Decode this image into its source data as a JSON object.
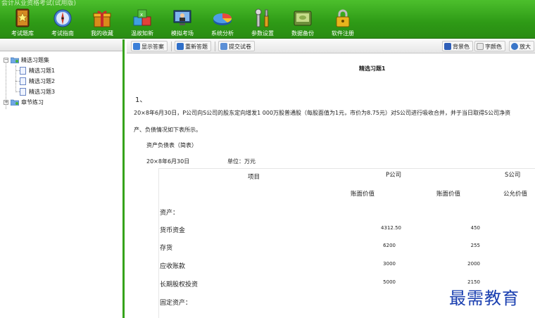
{
  "app": {
    "title": "会计从业资格考试(试用版)"
  },
  "toolbar": [
    {
      "label": "考试题库",
      "icon": "book-icon"
    },
    {
      "label": "考试指南",
      "icon": "compass-icon"
    },
    {
      "label": "我的收藏",
      "icon": "gift-box-icon"
    },
    {
      "label": "温故知新",
      "icon": "cubes-icon"
    },
    {
      "label": "模拟考场",
      "icon": "monitor-user-icon"
    },
    {
      "label": "系统分析",
      "icon": "pie-chart-icon"
    },
    {
      "label": "参数设置",
      "icon": "tools-icon"
    },
    {
      "label": "数据备份",
      "icon": "disk-icon"
    },
    {
      "label": "软件注册",
      "icon": "lock-icon"
    }
  ],
  "tree": {
    "root1": "精选习题集",
    "items": [
      "精选习题1",
      "精选习题2",
      "精选习题3"
    ],
    "root2": "章节练习"
  },
  "content_toolbar": {
    "show_answer": "显示答案",
    "redo": "重新答题",
    "submit": "提交试卷",
    "bg_color": "背景色",
    "font_color": "字颜色",
    "zoom": "放大"
  },
  "document": {
    "title": "精选习题1",
    "question_number": "1、",
    "text_line1": "20×8年6月30日，P公司向S公司的股东定向增发1 000万股普通股（每股面值为1元，市价为8.75元）对S公司进行吸收合并，并于当日取得S公司净资",
    "text_line2": "产、负债情况如下表所示。",
    "table_title": "资产负债表（简表）",
    "table_date": "20×8年6月30日",
    "table_unit": "单位：万元",
    "table": {
      "col_item": "项目",
      "col_p": "P公司",
      "col_s": "S公司",
      "sub_p_book": "账面价值",
      "sub_s_book": "账面价值",
      "sub_s_fair": "公允价值",
      "rows": [
        {
          "label": "资产：",
          "p": "",
          "s": ""
        },
        {
          "label": "货币资金",
          "p": "4312.50",
          "s": "450"
        },
        {
          "label": "存货",
          "p": "6200",
          "s": "255"
        },
        {
          "label": "应收账款",
          "p": "3000",
          "s": "2000"
        },
        {
          "label": "长期股权投资",
          "p": "5000",
          "s": "2150"
        },
        {
          "label": "固定资产：",
          "p": "",
          "s": ""
        }
      ]
    }
  },
  "watermark": "最需教育",
  "colors": {
    "toolbar_green": "#3aaf1f",
    "accent_blue": "#1a3fb0"
  }
}
